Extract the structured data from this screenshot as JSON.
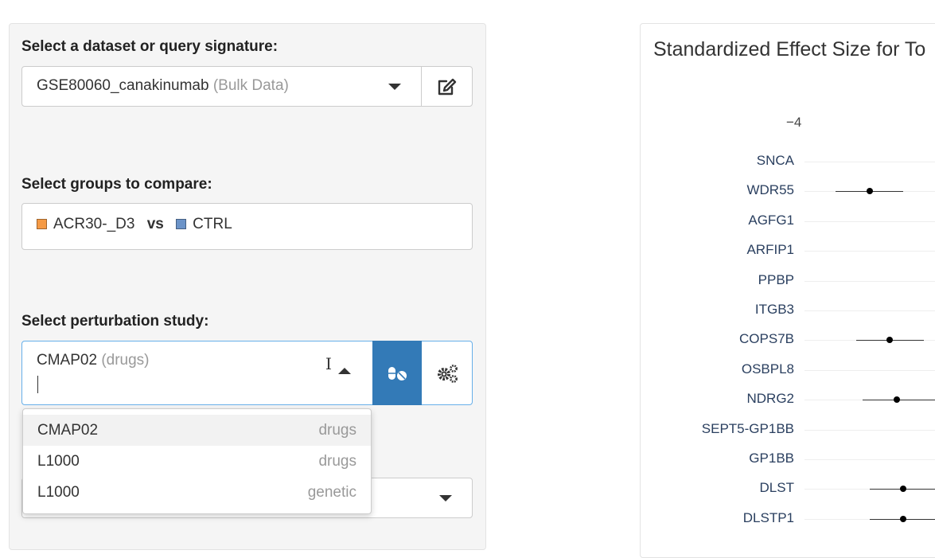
{
  "left_panel": {
    "dataset": {
      "label": "Select a dataset or query signature:",
      "value": "GSE80060_canakinumab",
      "value_suffix": "(Bulk Data)"
    },
    "groups": {
      "label": "Select groups to compare:",
      "group1": "ACR30-_D3",
      "vs": "vs",
      "group2": "CTRL",
      "group1_color": "#f59a45",
      "group2_color": "#6b93c8"
    },
    "perturbation": {
      "label": "Select perturbation study:",
      "value": "CMAP02",
      "value_suffix": "(drugs)",
      "options": [
        {
          "name": "CMAP02",
          "type": "drugs"
        },
        {
          "name": "L1000",
          "type": "drugs"
        },
        {
          "name": "L1000",
          "type": "genetic"
        }
      ],
      "accent": "#337ab7"
    }
  },
  "plot": {
    "title": "Standardized Effect Size for To",
    "chart_data": {
      "type": "scatter",
      "x_ticks": [
        "−4"
      ],
      "genes": [
        "SNCA",
        "WDR55",
        "AGFG1",
        "ARFIP1",
        "PPBP",
        "ITGB3",
        "COPS7B",
        "OSBPL8",
        "NDRG2",
        "SEPT5-GP1BB",
        "GP1BB",
        "DLST",
        "DLSTP1"
      ],
      "points": [
        {
          "gene": "WDR55",
          "x": -2.9,
          "lo": -3.4,
          "hi": -2.4
        },
        {
          "gene": "COPS7B",
          "x": -2.6,
          "lo": -3.1,
          "hi": -2.1
        },
        {
          "gene": "NDRG2",
          "x": -2.5,
          "lo": -3.0,
          "hi": -1.9
        },
        {
          "gene": "DLST",
          "x": -2.4,
          "lo": -2.9,
          "hi": -1.9
        },
        {
          "gene": "DLSTP1",
          "x": -2.4,
          "lo": -2.9,
          "hi": -1.9
        }
      ]
    }
  }
}
